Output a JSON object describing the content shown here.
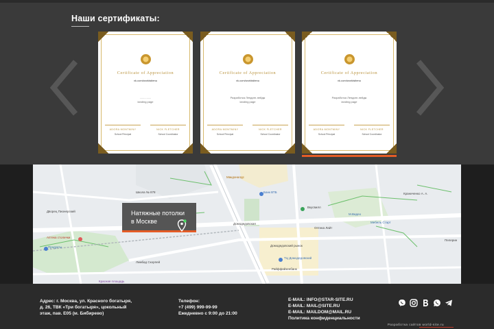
{
  "certificates": {
    "title": "Наши сертификаты:",
    "items": [
      {
        "heading": "Certificate of Appreciation",
        "url": "vk.com/worldsitenu",
        "text_line1": "...............",
        "text_line2": "landing page",
        "signer_left": "ADORA MONTMINY",
        "role_left": "School Principal",
        "signer_right": "NICK FLETCHER",
        "role_right": "School Coordinator"
      },
      {
        "heading": "Certificate of Appreciation",
        "url": "vk.com/worldsitenu",
        "text_line1": "Разработка Лендинг-пейдж",
        "text_line2": "landing page",
        "signer_left": "ADORA MONTMINY",
        "role_left": "School Principal",
        "signer_right": "NICK FLETCHER",
        "role_right": "School Coordinator"
      },
      {
        "heading": "Certificate of Appreciation",
        "url": "vk.com/worldsitenu",
        "text_line1": "Разработка Лендинг-пейдж",
        "text_line2": "landing page",
        "signer_left": "ADORA MONTMINY",
        "role_left": "School Principal",
        "signer_right": "NICK FLETCHER",
        "role_right": "School Coordinator"
      }
    ]
  },
  "map": {
    "popup_text": "Натяжные потолки в Москве",
    "labels": {
      "school": "Школа № 878",
      "mcdonalds": "Макдоналдс",
      "dvorets": "Дворец Пионерский",
      "vtb": "Банк ВТБ",
      "domodedovskaya": "Домодедовская",
      "apteka": "Аптека столички",
      "produkty": "Продукты",
      "market": "Домодедовский рынок",
      "tc": "ТЦ Домодедовский",
      "raif": "Райффайзенбанк",
      "lidl": "Лимбад Скорпей",
      "krasnaya": "Красная площадь",
      "vkusvill": "Вкусвилл",
      "mvideo": "М.Видео",
      "kraniki": "Краниченко А. А.",
      "pelerin": "Пелерин",
      "mebel": "Мебель Старт",
      "ochki": "Оптика Лайт"
    }
  },
  "footer": {
    "address_line1": "Адрес: г. Москва, ул. Красного богатыря,",
    "address_line2": "д. 26, ТВК «Три богатыря», цокольный",
    "address_line3": "этаж, пав. Е05 (м. Бибирево)",
    "phone_label": "Телефон:",
    "phone": "+7 (499) 999-99-99",
    "hours": "Ежедневно с 9:00 до 21:00",
    "email1": "E-MAIL: INFO@STAR-SITE.RU",
    "email2": "E-MAIL: MAIL@SITE.RU",
    "email3": "E-MAIL: MAILDOM@MAIL.RU",
    "privacy": "Политика конфиденциальности",
    "dev_credit": "Разработка сайтов world-site.ru"
  }
}
